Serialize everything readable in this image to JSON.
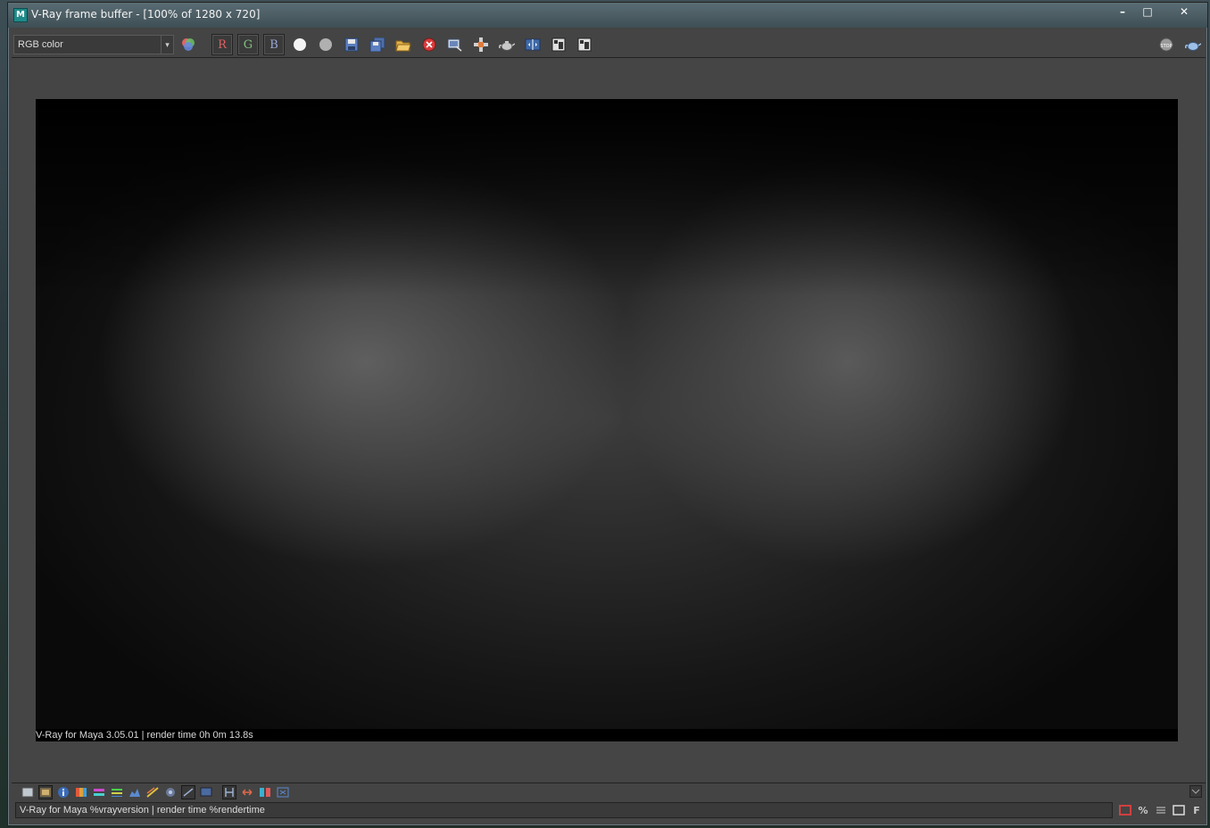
{
  "window": {
    "title": "V-Ray frame buffer - [100% of 1280 x 720]",
    "icon": "maya-app-icon",
    "controls": {
      "minimize": "–",
      "maximize": "□",
      "close": "✕"
    }
  },
  "toolbar": {
    "channel_select": {
      "value": "RGB color",
      "arrow": "▾"
    },
    "channels": {
      "r": "R",
      "g": "G",
      "b": "B"
    },
    "buttons": [
      "color-corrections-icon",
      "red-channel",
      "green-channel",
      "blue-channel",
      "mono-white-icon",
      "mono-gray-icon",
      "save-image-icon",
      "save-all-images-icon",
      "load-image-icon",
      "clear-image-icon",
      "region-render-icon",
      "track-mouse-icon",
      "render-teapot-icon",
      "compare-ab-icon",
      "history-a-icon",
      "history-b-icon"
    ],
    "right_buttons": [
      "stop-render-icon",
      "render-icon"
    ],
    "colors": {
      "red": "#e06060",
      "green": "#80c080",
      "blue": "#9aa8d8",
      "accent": "#1f8a8a"
    }
  },
  "render": {
    "stamp_text": "V-Ray for Maya 3.05.01 | render time  0h  0m 13.8s"
  },
  "bottom_toolbar": {
    "buttons": [
      "show-corrections-icon",
      "levels-icon",
      "info-icon",
      "color-balance-icon",
      "lut-icon",
      "curves-icon",
      "histogram-icon",
      "exposure-icon",
      "ocio-icon",
      "lens-effects-icon",
      "display-srgb-icon",
      "h-icon",
      "flip-icon",
      "compare-icon",
      "settings-icon"
    ]
  },
  "statusbar": {
    "stamp_field": "V-Ray for Maya %vrayversion | render time %rendertime",
    "buttons": {
      "percent": "%",
      "font": "F"
    }
  }
}
